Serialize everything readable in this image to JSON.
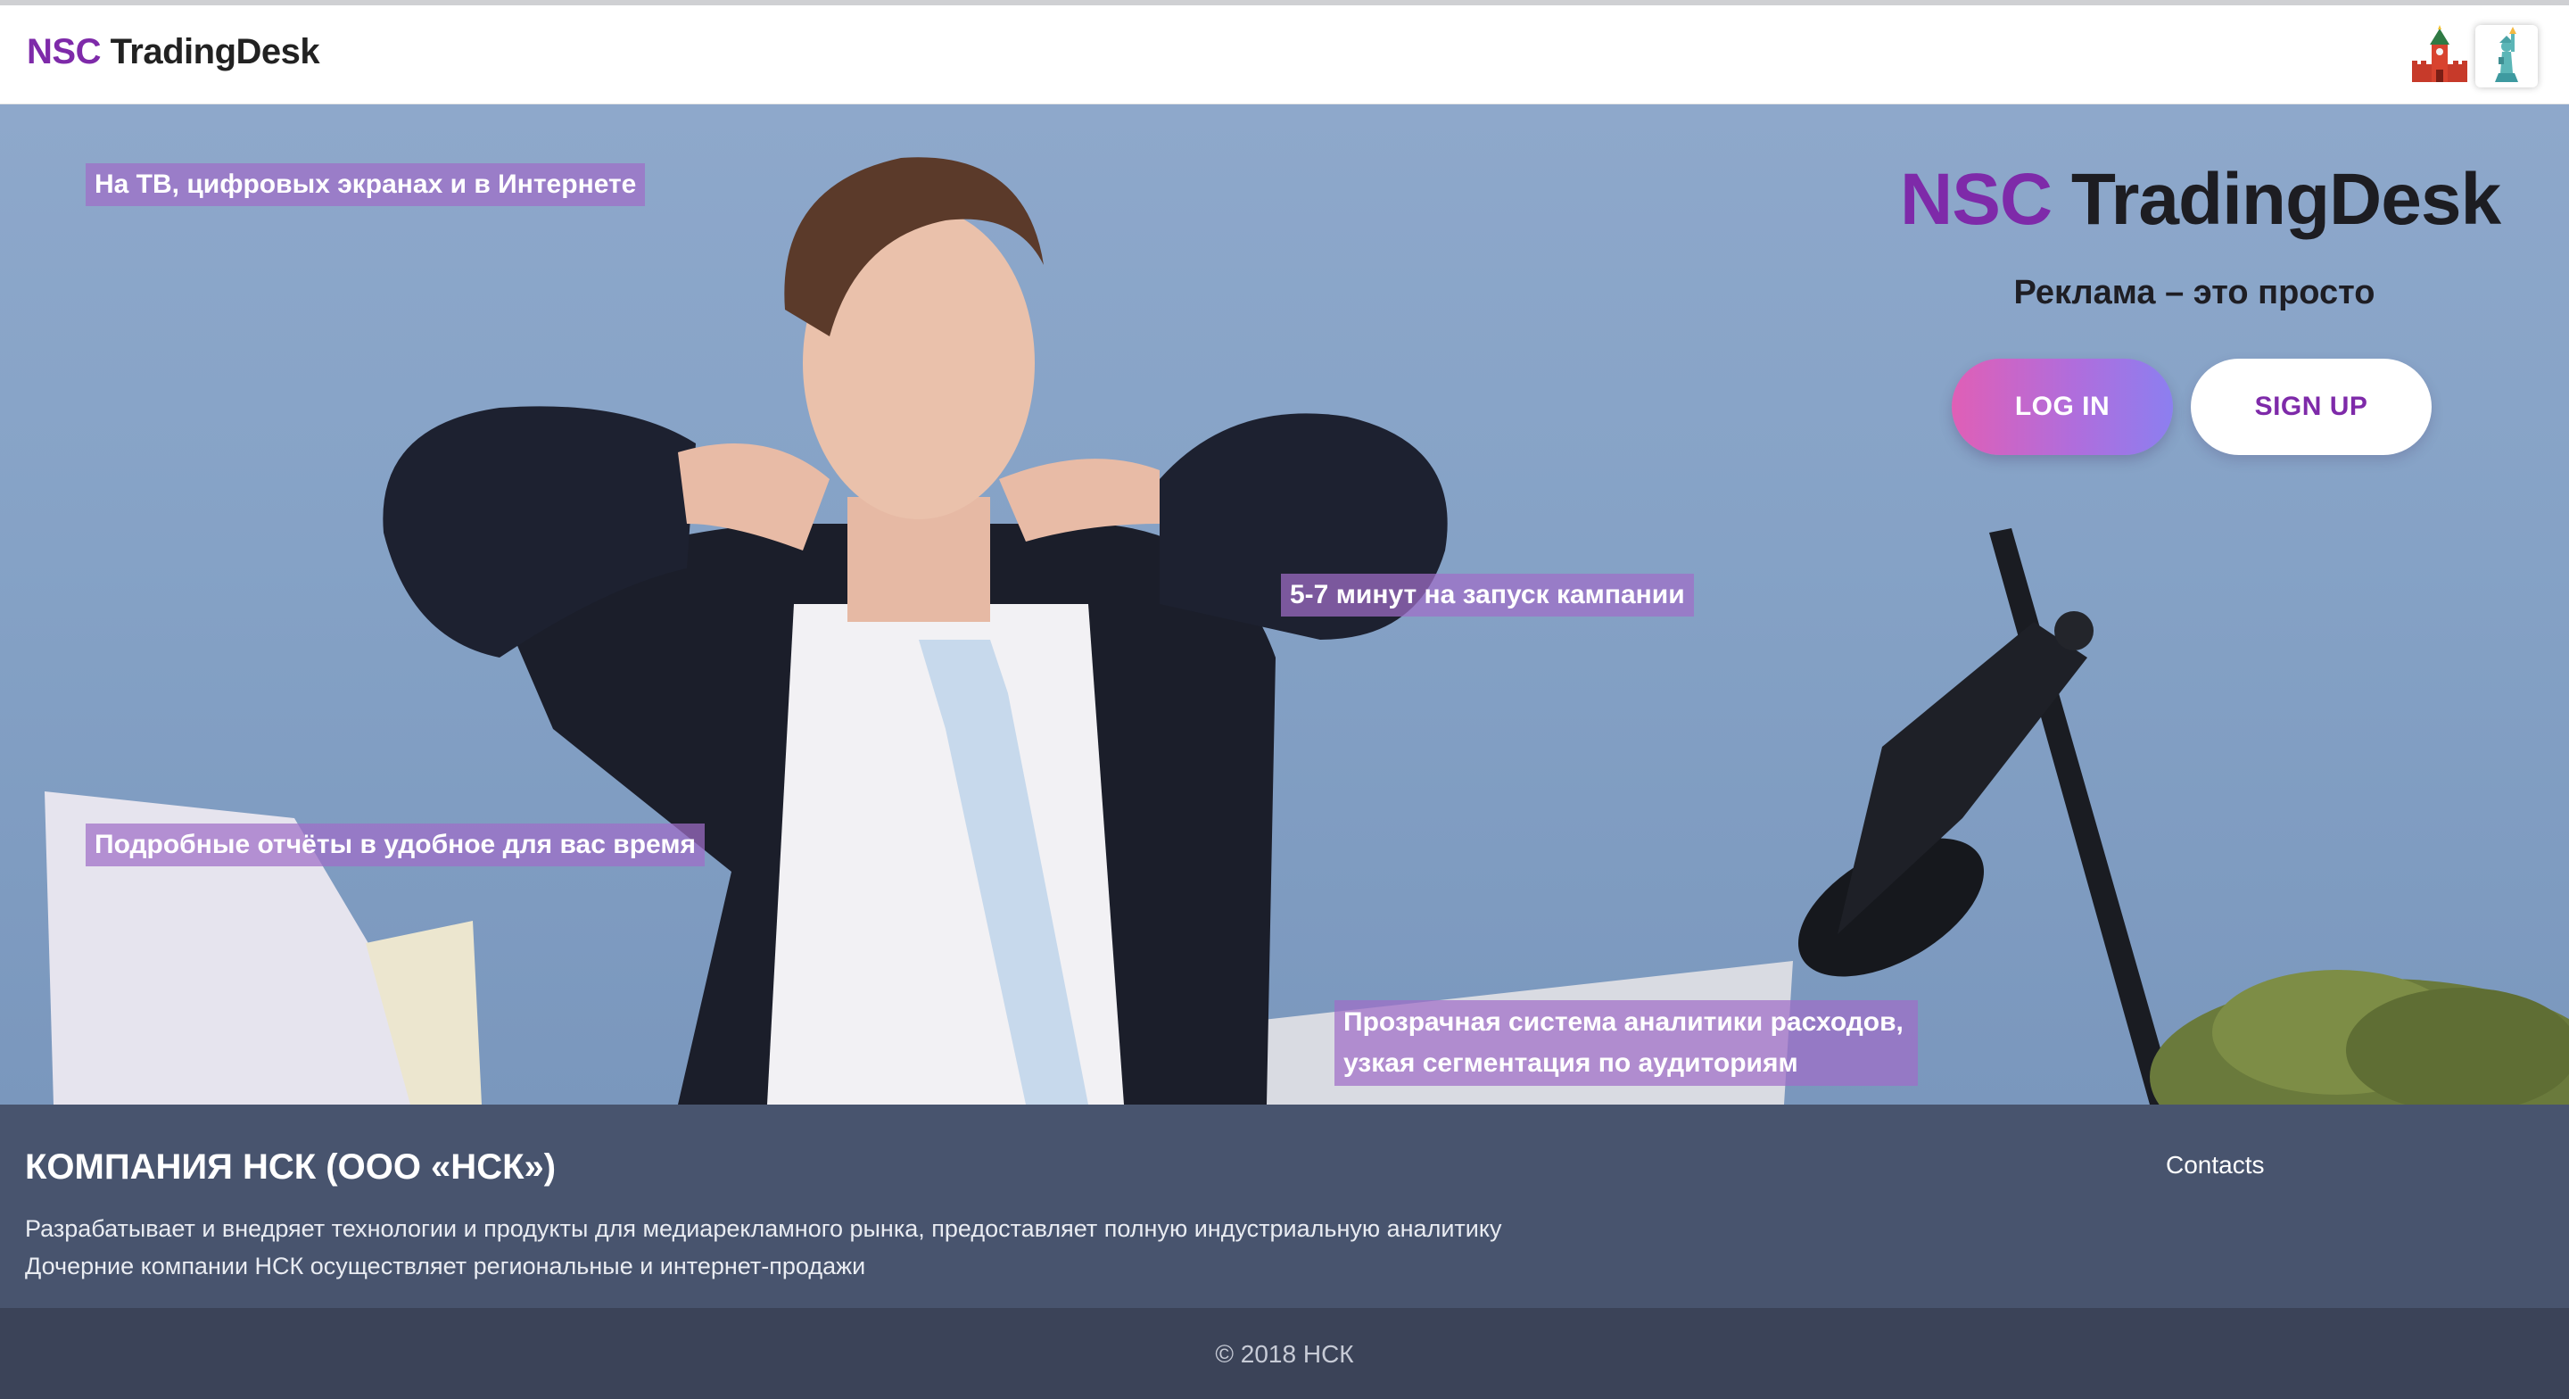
{
  "header": {
    "logo_prefix": "NSC",
    "logo_suffix": " TradingDesk",
    "lang_ru_icon": "kremlin-icon",
    "lang_en_icon": "statue-of-liberty-icon"
  },
  "hero": {
    "features": [
      "На ТВ, цифровых экранах и в Интернете",
      "5-7 минут на запуск кампании",
      "Подробные отчёты в удобное для вас время",
      "Прозрачная система аналитики расходов,",
      "узкая сегментация по аудиториям"
    ],
    "brand_prefix": "NSC",
    "brand_suffix": " TradingDesk",
    "tagline": "Реклама – это просто",
    "login_label": "LOG IN",
    "signup_label": "SIGN UP"
  },
  "footer": {
    "company": "КОМПАНИЯ НСК (ООО «НСК»)",
    "desc_line1": "Разрабатывает и внедряет технологии и продукты для медиарекламного рынка, предоставляет полную индустриальную аналитику",
    "desc_line2": "Дочерние компании НСК осуществляет региональные и интернет-продажи",
    "contacts_label": "Contacts",
    "copyright": "© 2018 НСК"
  },
  "colors": {
    "brand_purple": "#7e2aa9",
    "login_gradient_start": "#e05fb6",
    "login_gradient_end": "#8c7ff0",
    "footer_bg": "#48546e",
    "footer_bottom_bg": "#3b4358"
  }
}
